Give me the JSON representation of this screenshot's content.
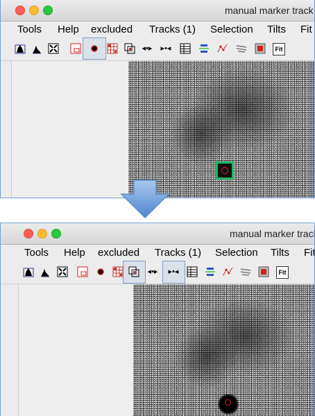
{
  "window": {
    "title": "manual marker track"
  },
  "menu": [
    "Tools",
    "Help",
    "excluded",
    "Tracks (1)",
    "Selection",
    "Tilts",
    "Fit"
  ],
  "toolbar_icons": [
    "histogram-icon",
    "histogram-filled-icon",
    "fit-to-window-icon",
    "region-icon",
    "marker-dot-icon",
    "grid-icon",
    "overlay-icon",
    "expand-horizontal-icon",
    "contract-horizontal-icon",
    "table-icon",
    "align-icon",
    "track-path-icon",
    "lines-icon",
    "red-square-icon",
    "fit-icon"
  ],
  "toolbar": {
    "fit_label": "Fit"
  },
  "colors": {
    "panel_border": "#6f9fd1",
    "marker": "#18b85e",
    "arrow": "#6a9fd8"
  }
}
